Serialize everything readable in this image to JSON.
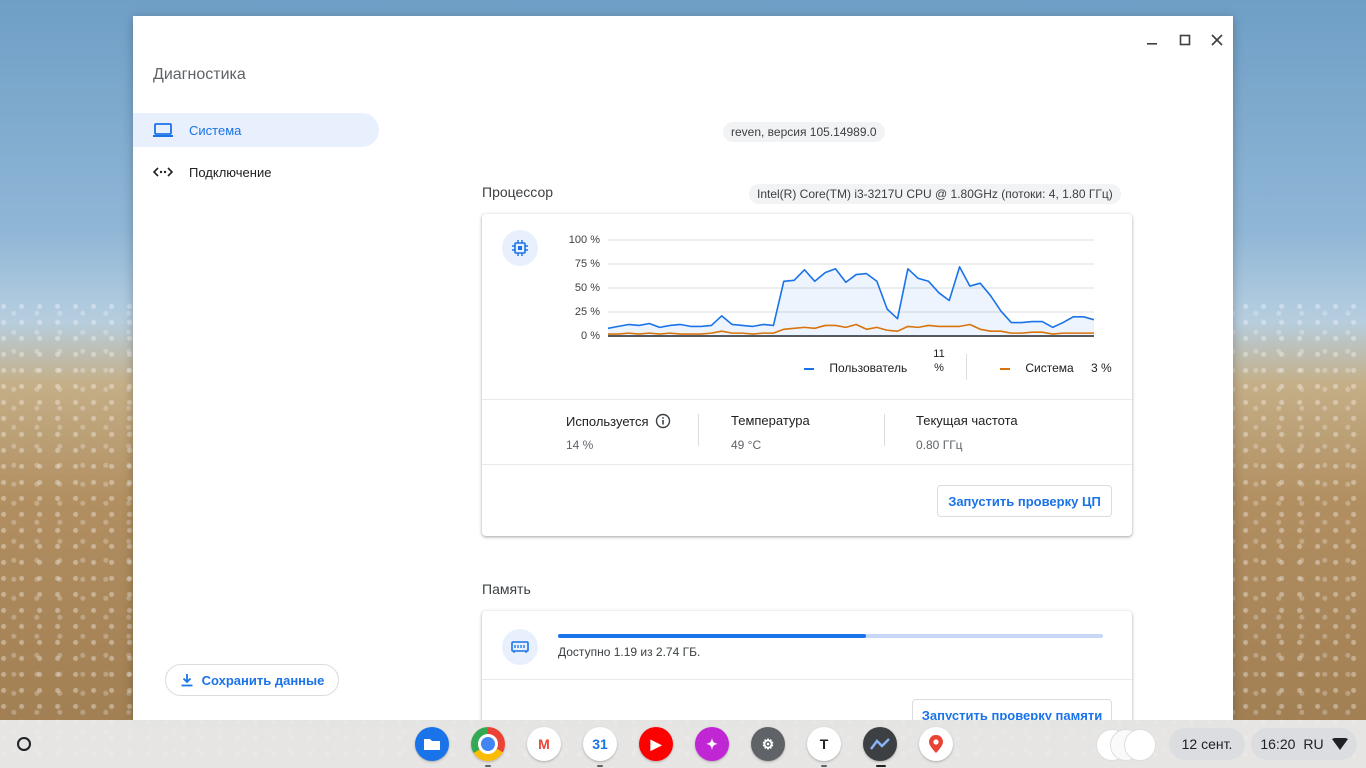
{
  "window": {
    "app_title": "Диагностика",
    "controls": {
      "minimize": "—",
      "maximize": "☐",
      "close": "✕"
    }
  },
  "sidebar": {
    "items": [
      {
        "label": "Система",
        "icon": "laptop-icon",
        "active": true
      },
      {
        "label": "Подключение",
        "icon": "connection-icon",
        "active": false
      }
    ],
    "save_button": "Сохранить данные"
  },
  "version_chip": "reven, версия 105.14989.0",
  "cpu": {
    "section_title": "Процессор",
    "model_chip": "Intel(R) Core(TM) i3-3217U CPU @ 1.80GHz (потоки: 4, 1.80 ГГц)",
    "legend": {
      "user_label": "Пользователь",
      "user_value_num": "11",
      "user_value_unit": "%",
      "system_label": "Система",
      "system_value": "3 %"
    },
    "stats": {
      "usage_label": "Используется",
      "usage_value": "14 %",
      "temp_label": "Температура",
      "temp_value": "49 °C",
      "freq_label": "Текущая частота",
      "freq_value": "0.80 ГГц"
    },
    "run_button": "Запустить проверку ЦП"
  },
  "chart_data": {
    "type": "area",
    "ylim": [
      0,
      100
    ],
    "y_ticks": [
      "100 %",
      "75 %",
      "50 %",
      "25 %",
      "0 %"
    ],
    "grid": true,
    "legend_position": "bottom-right",
    "series": [
      {
        "name": "Пользователь",
        "color": "#1a73e8",
        "values": [
          8,
          10,
          12,
          11,
          13,
          9,
          11,
          12,
          10,
          10,
          11,
          21,
          12,
          11,
          10,
          12,
          11,
          57,
          58,
          69,
          57,
          66,
          70,
          56,
          64,
          65,
          57,
          28,
          18,
          70,
          60,
          57,
          45,
          37,
          72,
          52,
          55,
          42,
          26,
          14,
          14,
          15,
          15,
          9,
          14,
          20,
          20,
          17
        ]
      },
      {
        "name": "Система",
        "color": "#d9730d",
        "values": [
          2,
          2,
          3,
          2,
          3,
          2,
          3,
          2,
          2,
          2,
          3,
          5,
          3,
          3,
          2,
          3,
          3,
          7,
          8,
          9,
          8,
          11,
          11,
          9,
          12,
          7,
          9,
          6,
          5,
          10,
          9,
          11,
          10,
          10,
          10,
          12,
          7,
          5,
          5,
          3,
          3,
          4,
          4,
          2,
          3,
          3,
          3,
          3
        ]
      }
    ]
  },
  "memory": {
    "section_title": "Память",
    "available_text": "Доступно 1.19 из 2.74 ГБ.",
    "used_fraction": 0.566,
    "run_button": "Запустить проверку памяти"
  },
  "shelf": {
    "apps": [
      {
        "name": "files-app-icon",
        "glyph": "",
        "bg": "#1a73e8",
        "fg": "#ffffff"
      },
      {
        "name": "chrome-app-icon",
        "glyph": "",
        "bg": "#4285f4",
        "fg": "#ffffff"
      },
      {
        "name": "gmail-app-icon",
        "glyph": "M",
        "bg": "#ffffff",
        "fg": "#ea4335"
      },
      {
        "name": "calendar-app-icon",
        "glyph": "31",
        "bg": "#ffffff",
        "fg": "#1a73e8"
      },
      {
        "name": "youtube-app-icon",
        "glyph": "▶",
        "bg": "#ff0000",
        "fg": "#ffffff"
      },
      {
        "name": "gallery-app-icon",
        "glyph": "✦",
        "bg": "#c026d3",
        "fg": "#ffffff"
      },
      {
        "name": "settings-app-icon",
        "glyph": "⚙",
        "bg": "#5f6368",
        "fg": "#ffffff"
      },
      {
        "name": "tasks-app-icon",
        "glyph": "T",
        "bg": "#ffffff",
        "fg": "#202124"
      },
      {
        "name": "diagnostics-app-icon",
        "glyph": "",
        "bg": "#3c4043",
        "fg": "#ffffff"
      },
      {
        "name": "maps-app-icon",
        "glyph": "",
        "bg": "#ffffff",
        "fg": "#34a853"
      }
    ],
    "date": "12 сент.",
    "time": "16:20",
    "lang": "RU"
  }
}
